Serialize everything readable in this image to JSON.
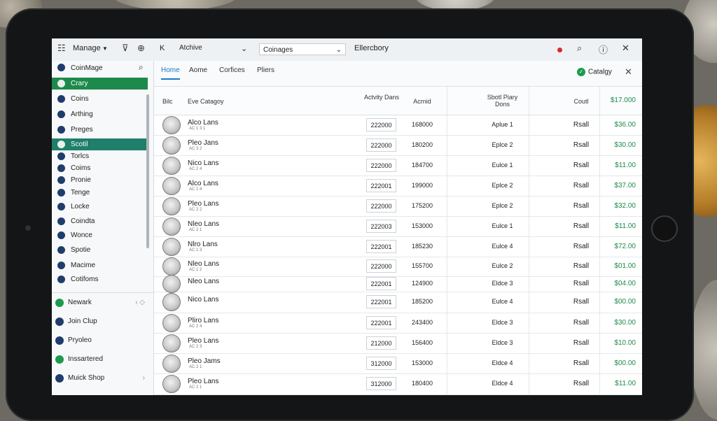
{
  "topbar": {
    "manage_label": "Manage",
    "back_label": "K",
    "archive_label": "Atchive",
    "dropdown_value": "Coinages",
    "title": "Ellercbory"
  },
  "sidebar": {
    "app_name": "CoinMage",
    "items": [
      {
        "label": "Crary",
        "style": "green"
      },
      {
        "label": "Coins",
        "style": ""
      },
      {
        "label": "Arthing",
        "style": ""
      },
      {
        "label": "Preges",
        "style": ""
      },
      {
        "label": "Scotil",
        "style": "teal"
      },
      {
        "label": "Torlcs",
        "style": ""
      },
      {
        "label": "Coims",
        "style": ""
      },
      {
        "label": "Pronie",
        "style": ""
      },
      {
        "label": "Tenge",
        "style": ""
      },
      {
        "label": "Locke",
        "style": ""
      },
      {
        "label": "Coindta",
        "style": ""
      },
      {
        "label": "Wonce",
        "style": ""
      },
      {
        "label": "Spotie",
        "style": ""
      },
      {
        "label": "Macime",
        "style": ""
      },
      {
        "label": "Cotifoms",
        "style": ""
      }
    ],
    "bottom_items": [
      {
        "label": "Newark",
        "arrow": "‹ ◇"
      },
      {
        "label": "Join Clup",
        "arrow": ""
      },
      {
        "label": "Pryoleo",
        "arrow": ""
      },
      {
        "label": "Inssartered",
        "arrow": ""
      },
      {
        "label": "Muick Shop",
        "arrow": "›"
      }
    ]
  },
  "main": {
    "tabs": [
      "Home",
      "Aome",
      "Corfices",
      "Pliers"
    ],
    "catalog_button": "Catalgy",
    "headers": {
      "col0": "Bilc",
      "col1": "Eve Catagoy",
      "col2": "Actvity Dans",
      "col3": "Acrnid",
      "col4": "Sbotl Piary Dons",
      "col5": "Coutl",
      "total": "$17.000"
    },
    "rows": [
      {
        "name": "Alco Lans",
        "sub": "AC 1 3 1",
        "box": "222000",
        "num": "168000",
        "level": "Aplue 1",
        "type": "Rsall",
        "price": "$36.00"
      },
      {
        "name": "Pleo Jans",
        "sub": "AC 3 2",
        "box": "222000",
        "num": "180200",
        "level": "Eplce 2",
        "type": "Rsall",
        "price": "$30.00"
      },
      {
        "name": "Nico Lans",
        "sub": "AC 2 4",
        "box": "222000",
        "num": "184700",
        "level": "Eulce 1",
        "type": "Rsall",
        "price": "$11.00"
      },
      {
        "name": "Alco Lans",
        "sub": "AC 2 4",
        "box": "222001",
        "num": "199000",
        "level": "Eplce 2",
        "type": "Rsall",
        "price": "$37.00"
      },
      {
        "name": "Pleo Lans",
        "sub": "AC 2 2",
        "box": "222000",
        "num": "175200",
        "level": "Eplce 2",
        "type": "Rsall",
        "price": "$32.00"
      },
      {
        "name": "Nleo Lans",
        "sub": "AC 2 1",
        "box": "222003",
        "num": "153000",
        "level": "Eulce 1",
        "type": "Rsall",
        "price": "$11.00"
      },
      {
        "name": "Nlro Lans",
        "sub": "AC 1 3",
        "box": "222001",
        "num": "185230",
        "level": "Eulce 4",
        "type": "Rsall",
        "price": "$72.00"
      },
      {
        "name": "Nleo Lans",
        "sub": "AC 1 2",
        "box": "222000",
        "num": "155700",
        "level": "Eulce 2",
        "type": "Rsall",
        "price": "$01.00"
      },
      {
        "name": "Nleo Lans",
        "sub": "",
        "box": "222001",
        "num": "124900",
        "level": "Eldce 3",
        "type": "Rsall",
        "price": "$04.00"
      },
      {
        "name": "Nico Lans",
        "sub": "",
        "box": "222001",
        "num": "185200",
        "level": "Eulce 4",
        "type": "Rsall",
        "price": "$00.00"
      },
      {
        "name": "Pliro Lans",
        "sub": "AC 2 4",
        "box": "222001",
        "num": "243400",
        "level": "Eldce 3",
        "type": "Rsall",
        "price": "$30.00"
      },
      {
        "name": "Pleo Lans",
        "sub": "AC 2 3",
        "box": "212000",
        "num": "156400",
        "level": "Eldce 3",
        "type": "Rsall",
        "price": "$10.00"
      },
      {
        "name": "Pleo Jams",
        "sub": "AC 2 1",
        "box": "312000",
        "num": "153000",
        "level": "Eldce 4",
        "type": "Rsall",
        "price": "$00.00"
      },
      {
        "name": "Pleo Lans",
        "sub": "AC 2 1",
        "box": "312000",
        "num": "180400",
        "level": "Eldce 4",
        "type": "Rsall",
        "price": "$11.00"
      }
    ]
  },
  "colors": {
    "accent_green": "#1c8a4a",
    "accent_blue": "#1b78c8",
    "teal": "#1f7f6b"
  }
}
